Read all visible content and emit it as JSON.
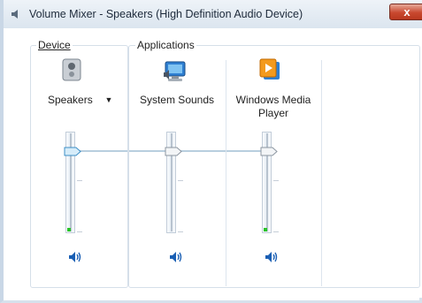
{
  "window": {
    "title": "Volume Mixer - Speakers (High Definition Audio Device)",
    "close_symbol": "x"
  },
  "device": {
    "group_label": "Device",
    "name": "Speakers",
    "dropdown_symbol": "▼",
    "icon": "speaker-device-icon",
    "volume_level": 0.76,
    "mute_icon": "speaker-mute-icon"
  },
  "applications": {
    "group_label": "Applications",
    "items": [
      {
        "name": "System Sounds",
        "icon": "system-sounds-icon",
        "volume_level": 0.76,
        "mute_icon": "speaker-mute-icon"
      },
      {
        "name": "Windows Media Player",
        "icon": "windows-media-player-icon",
        "volume_level": 0.76,
        "mute_icon": "speaker-mute-icon"
      }
    ]
  },
  "colors": {
    "accent": "#5fa7d8",
    "level_indicator": "#28c328",
    "speaker_icon": "#1a5fb4"
  }
}
